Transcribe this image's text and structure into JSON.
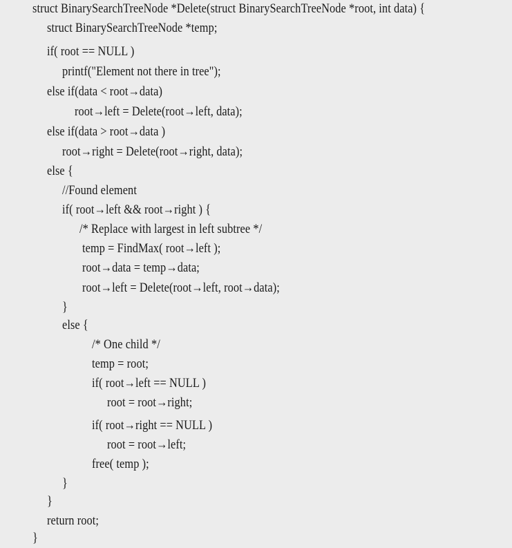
{
  "code": {
    "lines": [
      {
        "text": "struct BinarySearchTreeNode *Delete(struct BinarySearchTreeNode *root, int data) {"
      },
      {
        "text": "struct BinarySearchTreeNode *temp;"
      },
      {
        "text": "if( root == NULL )"
      },
      {
        "text": "printf(\"Element not there in tree\");"
      },
      {
        "text": "else if(data < root→data)"
      },
      {
        "text": "root→left = Delete(root→left, data);"
      },
      {
        "text": "else if(data > root→data )"
      },
      {
        "text": "root→right = Delete(root→right, data);"
      },
      {
        "text": "else {"
      },
      {
        "text": "//Found element"
      },
      {
        "text": "if( root→left && root→right ) {"
      },
      {
        "text": "/* Replace with largest in left subtree */"
      },
      {
        "text": "temp = FindMax( root→left );"
      },
      {
        "text": "root→data = temp→data;"
      },
      {
        "text": "root→left = Delete(root→left, root→data);"
      },
      {
        "text": "}"
      },
      {
        "text": "else {"
      },
      {
        "text": "/* One child */"
      },
      {
        "text": "temp = root;"
      },
      {
        "text": "if( root→left == NULL )"
      },
      {
        "text": "root = root→right;"
      },
      {
        "text": "if( root→right == NULL )"
      },
      {
        "text": "root = root→left;"
      },
      {
        "text": "free( temp );"
      },
      {
        "text": "}"
      },
      {
        "text": "}"
      },
      {
        "text": "return root;"
      },
      {
        "text": "}"
      }
    ]
  }
}
